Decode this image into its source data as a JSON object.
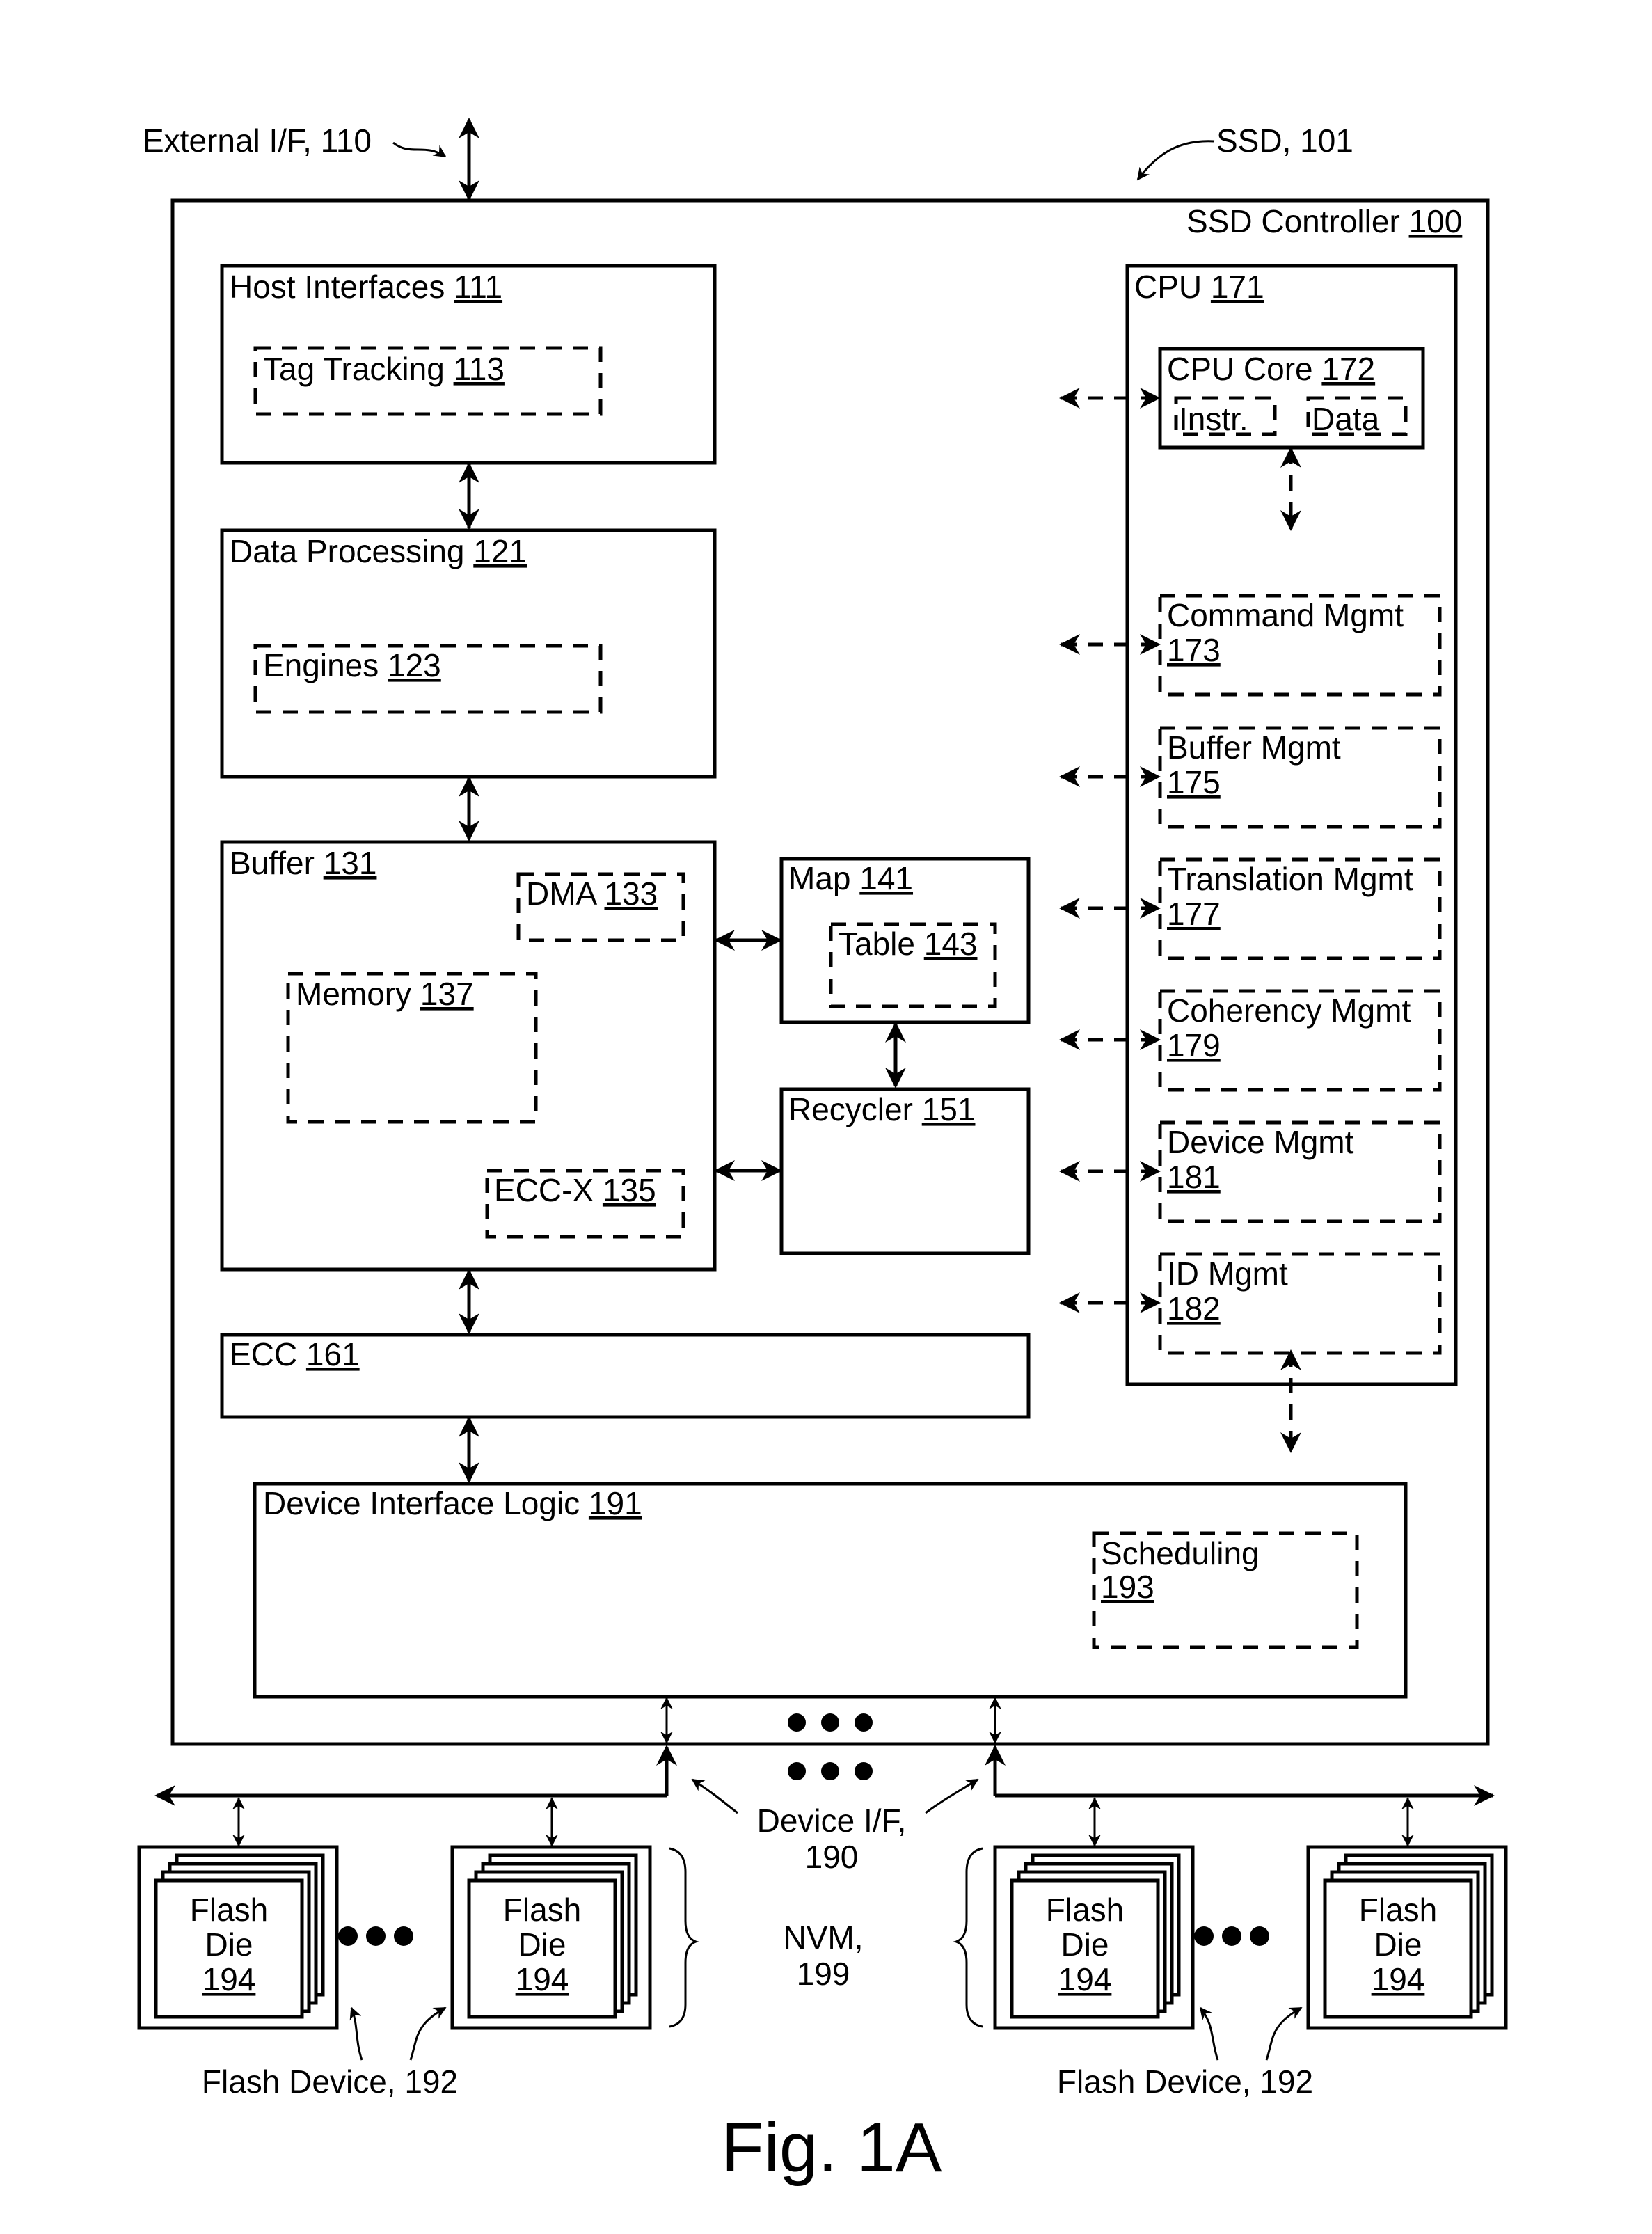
{
  "figure": {
    "caption": "Fig. 1A",
    "external_if": "External I/F, 110",
    "ssd": "SSD, 101",
    "device_if_line1": "Device I/F,",
    "device_if_line2": "190",
    "nvm_line1": "NVM,",
    "nvm_line2": "199",
    "flash_device_label": "Flash Device, 192"
  },
  "controller": {
    "label": "SSD Controller",
    "ref": "100"
  },
  "host_interfaces": {
    "label": "Host Interfaces",
    "ref": "111",
    "tag_tracking": {
      "label": "Tag Tracking",
      "ref": "113"
    }
  },
  "data_processing": {
    "label": "Data Processing",
    "ref": "121",
    "engines": {
      "label": "Engines",
      "ref": "123"
    }
  },
  "buffer": {
    "label": "Buffer",
    "ref": "131",
    "dma": {
      "label": "DMA",
      "ref": "133"
    },
    "memory": {
      "label": "Memory",
      "ref": "137"
    },
    "eccx": {
      "label": "ECC-X",
      "ref": "135"
    }
  },
  "map": {
    "label": "Map",
    "ref": "141",
    "table": {
      "label": "Table",
      "ref": "143"
    }
  },
  "recycler": {
    "label": "Recycler",
    "ref": "151"
  },
  "ecc": {
    "label": "ECC",
    "ref": "161"
  },
  "cpu": {
    "label": "CPU",
    "ref": "171",
    "core": {
      "label": "CPU Core",
      "ref": "172",
      "instr": "Instr.",
      "data": "Data"
    },
    "mgmt": [
      {
        "label": "Command Mgmt",
        "ref": "173"
      },
      {
        "label": "Buffer Mgmt",
        "ref": "175"
      },
      {
        "label": "Translation Mgmt",
        "ref": "177"
      },
      {
        "label": "Coherency Mgmt",
        "ref": "179"
      },
      {
        "label": "Device Mgmt",
        "ref": "181"
      },
      {
        "label": "ID Mgmt",
        "ref": "182"
      }
    ]
  },
  "device_interface_logic": {
    "label": "Device Interface Logic",
    "ref": "191",
    "scheduling": {
      "label": "Scheduling",
      "ref": "193"
    }
  },
  "flash_die": {
    "line1": "Flash",
    "line2": "Die",
    "ref": "194"
  }
}
